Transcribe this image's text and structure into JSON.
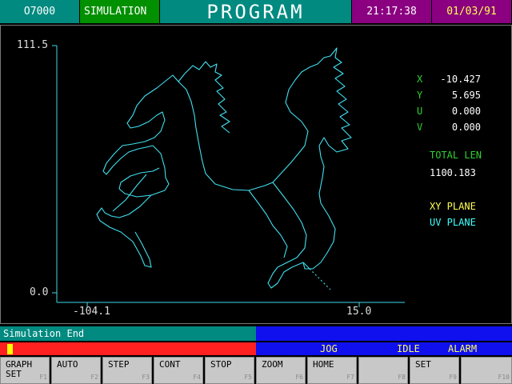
{
  "header": {
    "program_no": "O7000",
    "mode": "SIMULATION",
    "title": "PROGRAM",
    "time": "21:17:38",
    "date": "01/03/91"
  },
  "plot": {
    "y_max": "111.5",
    "y_min": "0.0",
    "x_min": "-104.1",
    "x_max": "15.0"
  },
  "coords": {
    "x_label": "X",
    "x_value": "-10.427",
    "y_label": "Y",
    "y_value": "5.695",
    "u_label": "U",
    "u_value": "0.000",
    "v_label": "V",
    "v_value": "0.000",
    "total_len_label": "TOTAL LEN",
    "total_len_value": "1100.183",
    "xy_plane": "XY PLANE",
    "uv_plane": "UV PLANE"
  },
  "status": {
    "message": "Simulation End",
    "jog": "JOG",
    "idle": "IDLE",
    "alarm": "ALARM"
  },
  "fkeys": [
    {
      "l1": "GRAPH",
      "l2": "SET",
      "n": "F1"
    },
    {
      "l1": "AUTO",
      "l2": "",
      "n": "F2"
    },
    {
      "l1": "STEP",
      "l2": "",
      "n": "F3"
    },
    {
      "l1": "CONT",
      "l2": "",
      "n": "F4"
    },
    {
      "l1": "STOP",
      "l2": "",
      "n": "F5"
    },
    {
      "l1": "ZOOM",
      "l2": "",
      "n": "F6"
    },
    {
      "l1": "HOME",
      "l2": "",
      "n": "F7"
    },
    {
      "l1": "",
      "l2": "",
      "n": "F8"
    },
    {
      "l1": "SET",
      "l2": "",
      "n": "F9"
    },
    {
      "l1": "",
      "l2": "",
      "n": "F10"
    }
  ],
  "colors": {
    "toolpath": "#40e0f0",
    "axis": "#40d8e8",
    "accent_teal": "#008a80",
    "accent_purple": "#8a0080"
  }
}
